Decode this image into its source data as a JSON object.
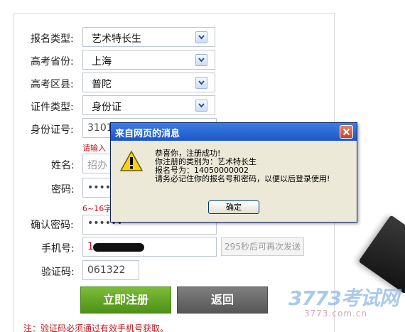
{
  "form": {
    "reg_type_label": "报名类型:",
    "reg_type_value": "艺术特长生",
    "province_label": "高考省份:",
    "province_value": "上海",
    "district_label": "高考区县:",
    "district_value": "普陀",
    "id_type_label": "证件类型:",
    "id_type_value": "身份证",
    "id_number_label": "身份证号:",
    "id_number_value": "3101",
    "id_hint": "请输入",
    "name_label": "姓名:",
    "name_value": "招办",
    "password_label": "密码:",
    "password_value": "••••",
    "password_hint": "6~16字",
    "confirm_label": "确认密码:",
    "confirm_value": "••••••",
    "phone_label": "手机号:",
    "phone_value": "1",
    "resend_label": "295秒后可再次发送",
    "captcha_label": "验证码:",
    "captcha_value": "061322",
    "submit_label": "立即注册",
    "back_label": "返回",
    "note": "注：验证码必须通过有效手机号获取。"
  },
  "dialog": {
    "title": "来自网页的消息",
    "line1": "恭喜你，注册成功!",
    "line2": "你注册的类别为：艺术特长生",
    "line3": "报名号为：14050000002",
    "line4": "请务必记住你的报名号和密码，以便以后登录使用!",
    "ok_label": "确定"
  },
  "watermark": {
    "main": "3773考试网",
    "sub": "3773.com.cn"
  },
  "colors": {
    "submit": "#5c9e22",
    "back": "#6b6b6b",
    "hint": "#c0141c",
    "dialog_title": "#2a64d4"
  }
}
